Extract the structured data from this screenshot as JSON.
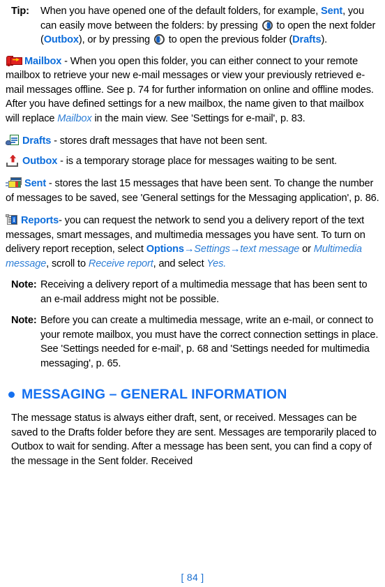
{
  "document": {
    "folio": "[ 84 ]"
  },
  "tip": {
    "label": "Tip:",
    "text_1": "When you have opened one of the default folders, for example, ",
    "link_sent": "Sent",
    "text_2": ", you can easily move between the folders: by pressing ",
    "icon_next": "joystick-right-icon",
    "text_3": " to open the next folder (",
    "link_outbox": "Outbox",
    "text_4": "), or by pressing ",
    "icon_prev": "joystick-left-icon",
    "text_5": " to open the previous folder (",
    "link_drafts": "Drafts",
    "text_6": ")."
  },
  "folders": [
    {
      "icon": "mailbox-icon",
      "name": "Mailbox",
      "text_1": " - When you open this folder, you can either connect to your remote mailbox to retrieve your new e-mail messages or view your previously retrieved e-mail messages offline. See p. 74 for further information on online and offline modes. After you have defined settings for a new mailbox, the name given to that mailbox will replace ",
      "emphasis": "Mailbox",
      "text_2": " in the main view. See 'Settings for e-mail', p. 83."
    },
    {
      "icon": "drafts-icon",
      "name": "Drafts",
      "text_1": " - stores draft messages that have not been sent."
    },
    {
      "icon": "outbox-icon",
      "name": "Outbox",
      "text_1": " - is a temporary storage place for messages waiting to be sent."
    },
    {
      "icon": "sent-icon",
      "name": "Sent",
      "text_1": " - stores the last 15 messages that have been sent. To change the number of messages to be saved, see 'General settings for the Messaging application', p. 86."
    }
  ],
  "reports": {
    "icon": "reports-icon",
    "name": "Reports",
    "badge_letter": "i",
    "text_1": "- you can request the network to send you a delivery report of the text messages, smart messages, and multimedia messages you have sent. To turn on delivery report reception, select ",
    "menu_options": "Options",
    "arrow_1": "→",
    "menu_settings": "Settings",
    "arrow_2": "→",
    "menu_text_message": "text message",
    "conj": " or ",
    "menu_multimedia_message": "Multimedia message",
    "text_2": ", scroll to ",
    "menu_receive_report": "Receive report",
    "text_3": ", and select ",
    "menu_yes": "Yes."
  },
  "notes": [
    {
      "label": "Note:",
      "text": "Receiving a delivery report of a multimedia message that has been sent to an e-mail address might not be possible."
    },
    {
      "label": "Note:",
      "text": "Before you can create a multimedia message, write an e-mail, or connect to your remote mailbox, you must have the correct connection settings in place. See 'Settings needed for e-mail', p. 68 and 'Settings needed for multimedia messaging', p. 65."
    }
  ],
  "section": {
    "heading": "MESSAGING – GENERAL INFORMATION",
    "body": "The message status is always either draft, sent, or received. Messages can be saved to the Drafts folder before they are sent. Messages are temporarily placed to Outbox to wait for sending. After a message has been sent, you can find a copy of the message in the Sent folder. Received"
  },
  "colors": {
    "link_blue": "#0d6ddb",
    "heading_blue": "#1570ef",
    "italic_blue": "#2f7fd6",
    "folio_blue": "#1a6fd0"
  }
}
